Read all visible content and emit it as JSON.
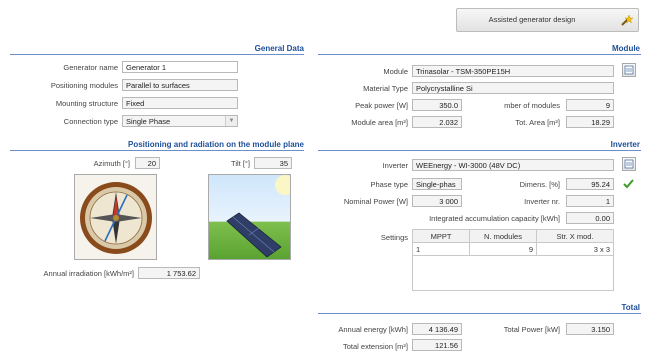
{
  "toolbar": {
    "assisted_label": "Assisted generator design",
    "wand_icon": "magic-wand-icon"
  },
  "general": {
    "title": "General Data",
    "generator_name_label": "Generator name",
    "generator_name": "Generator 1",
    "positioning_label": "Positioning modules",
    "positioning": "Parallel to surfaces",
    "mounting_label": "Mounting structure",
    "mounting": "Fixed",
    "connection_label": "Connection type",
    "connection": "Single Phase"
  },
  "radiation": {
    "title": "Positioning and radiation on the module plane",
    "azimuth_label": "Azimuth [°]",
    "azimuth": "20",
    "tilt_label": "Tilt [°]",
    "tilt": "35",
    "irradiation_label": "Annual irradiation [kWh/m²]",
    "irradiation": "1 753.62"
  },
  "module": {
    "title": "Module",
    "module_label": "Module",
    "module": "Trinasolar - TSM-350PE15H",
    "material_label": "Material Type",
    "material": "Polycrystalline Si",
    "peak_label": "Peak power [W]",
    "peak": "350.0",
    "nmod_label": "mber of modules",
    "nmod": "9",
    "area_label": "Module area [m²]",
    "area": "2.032",
    "tot_area_label": "Tot. Area [m²]",
    "tot_area": "18.29"
  },
  "inverter": {
    "title": "Inverter",
    "inverter_label": "Inverter",
    "inverter": "WEEnergy - WI-3000 (48V DC)",
    "phase_label": "Phase type",
    "phase": "Single-phas",
    "dimens_label": "Dimens. [%]",
    "dimens": "95.24",
    "nominal_label": "Nominal Power [W]",
    "nominal": "3 000",
    "invnr_label": "Inverter nr.",
    "invnr": "1",
    "capacity_label": "Integrated accumulation capacity [kWh]",
    "capacity": "0.00",
    "settings_label": "Settings",
    "settings_headers": [
      "MPPT",
      "N. modules",
      "Str. X mod."
    ],
    "settings_row": [
      "1",
      "9",
      "3 x 3"
    ]
  },
  "total": {
    "title": "Total",
    "energy_label": "Annual energy [kWh]",
    "energy": "4 136.49",
    "power_label": "Total Power [kW]",
    "power": "3.150",
    "extension_label": "Total extension [m²]",
    "extension": "121.56"
  }
}
